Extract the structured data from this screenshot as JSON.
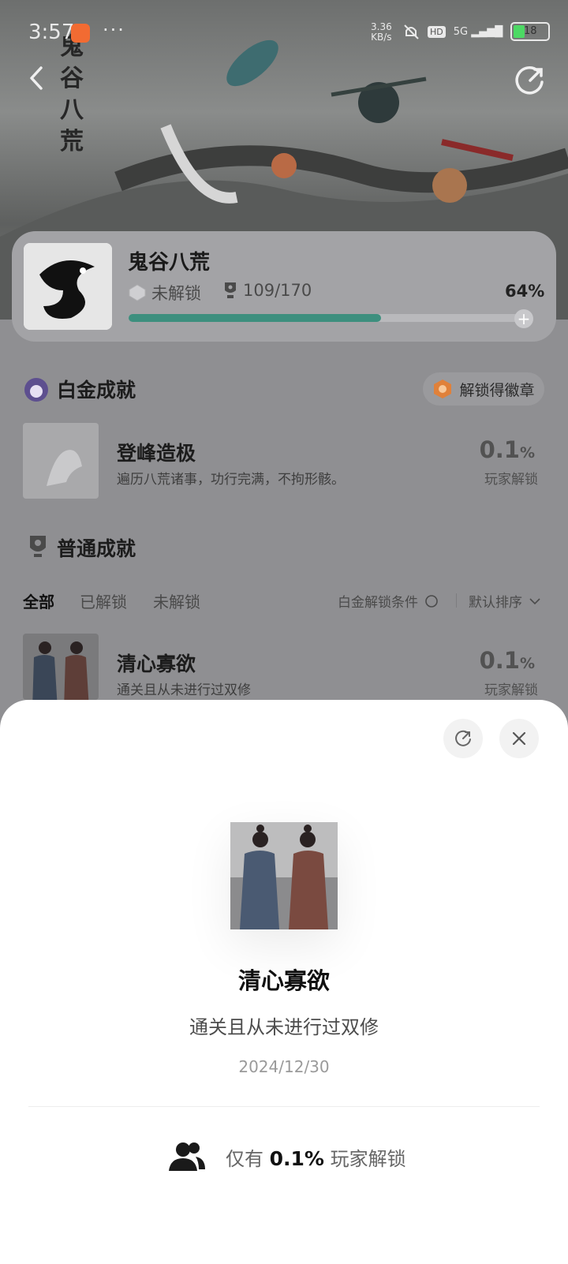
{
  "status_bar": {
    "time": "3:57",
    "dots": "···",
    "net_speed_value": "3.36",
    "net_speed_unit": "KB/s",
    "hd": "HD",
    "signal": "5G",
    "battery": "18"
  },
  "hero": {
    "logo_text": "鬼谷八荒"
  },
  "game": {
    "title": "鬼谷八荒",
    "lock_status": "未解锁",
    "trophy_count": "109/170",
    "progress_percent": "64%",
    "progress_value": 0.64
  },
  "platinum": {
    "section_title": "白金成就",
    "badge_button": "解锁得徽章",
    "achievement": {
      "name": "登峰造极",
      "description": "遍历八荒诸事，功行完满，不拘形骸。",
      "rate": "0.1",
      "rate_unit": "%",
      "rate_label": "玩家解锁"
    }
  },
  "normal": {
    "section_title": "普通成就",
    "tabs": [
      {
        "label": "全部"
      },
      {
        "label": "已解锁"
      },
      {
        "label": "未解锁"
      }
    ],
    "condition_label": "白金解锁条件",
    "sort_label": "默认排序",
    "items": [
      {
        "name": "清心寡欲",
        "description": "通关且从未进行过双修",
        "rate": "0.1",
        "rate_unit": "%",
        "rate_label": "玩家解锁"
      }
    ]
  },
  "sheet": {
    "name": "清心寡欲",
    "description": "通关且从未进行过双修",
    "date": "2024/12/30",
    "stat_prefix": "仅有",
    "stat_value": "0.1%",
    "stat_suffix": "玩家解锁"
  },
  "colors": {
    "accent": "#3d8f7e",
    "overlay": "#8f8f92",
    "badge": "#e0813a"
  }
}
